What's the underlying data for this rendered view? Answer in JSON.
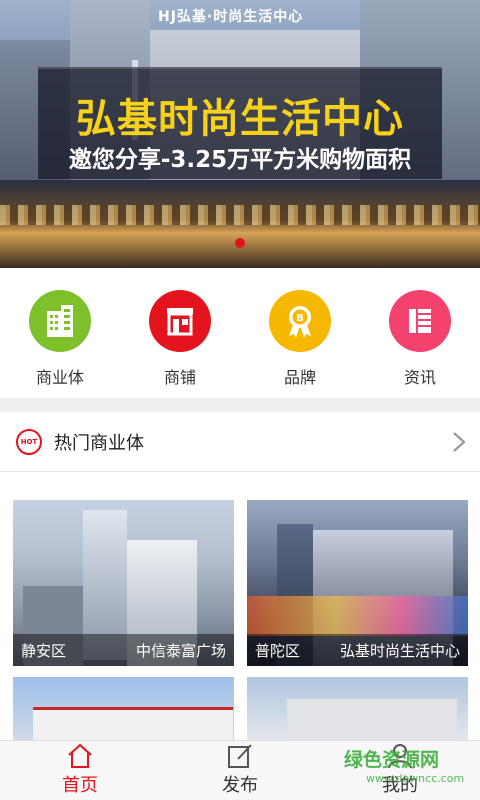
{
  "banner": {
    "sign_text": "HJ弘基·时尚生活中心",
    "headline": "弘基时尚生活中心",
    "subline": "邀您分享-3.25万平方米购物面积",
    "slide_count": 1,
    "active_slide": 1
  },
  "categories": [
    {
      "label": "商业体",
      "icon": "building-icon",
      "color": "#7dc02a"
    },
    {
      "label": "商铺",
      "icon": "shop-icon",
      "color": "#e3141e"
    },
    {
      "label": "品牌",
      "icon": "brand-badge-icon",
      "color": "#f6b800"
    },
    {
      "label": "资讯",
      "icon": "news-icon",
      "color": "#f2426d"
    }
  ],
  "section": {
    "badge": "HOT",
    "title": "热门商业体"
  },
  "cards": [
    {
      "district": "静安区",
      "name": "中信泰富广场"
    },
    {
      "district": "普陀区",
      "name": "弘基时尚生活中心"
    },
    {
      "district": "",
      "name": ""
    },
    {
      "district": "",
      "name": ""
    }
  ],
  "tabs": [
    {
      "label": "首页",
      "icon": "home-icon",
      "active": true
    },
    {
      "label": "发布",
      "icon": "edit-icon",
      "active": false
    },
    {
      "label": "我的",
      "icon": "user-icon",
      "active": false
    }
  ],
  "watermark": {
    "text": "绿色资源网",
    "sub": "www.downcc.com"
  },
  "colors": {
    "accent": "#e3141e",
    "headline": "#f7d21a"
  }
}
